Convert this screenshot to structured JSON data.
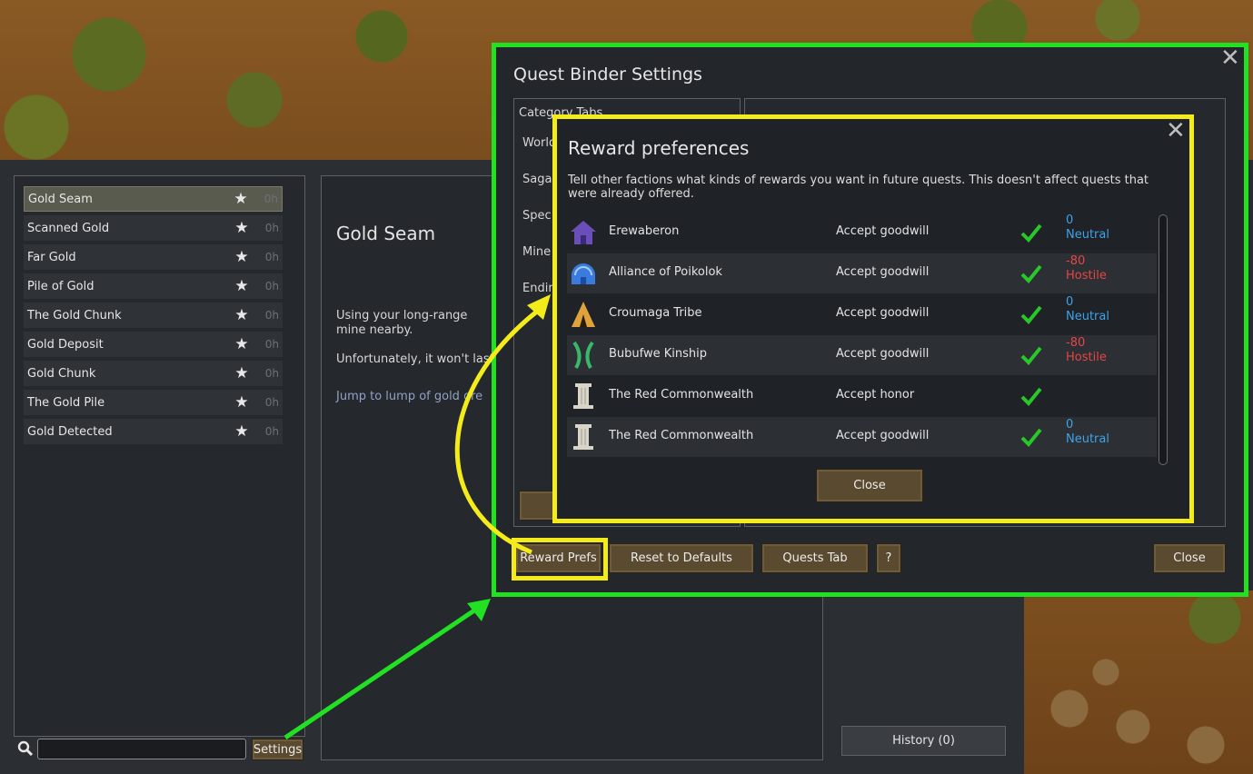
{
  "quest_list": {
    "items": [
      {
        "label": "Gold Seam",
        "time": "0h",
        "selected": true
      },
      {
        "label": "Scanned Gold",
        "time": "0h"
      },
      {
        "label": "Far Gold",
        "time": "0h"
      },
      {
        "label": "Pile of Gold",
        "time": "0h"
      },
      {
        "label": "The Gold Chunk",
        "time": "0h"
      },
      {
        "label": "Gold Deposit",
        "time": "0h"
      },
      {
        "label": "Gold Chunk",
        "time": "0h"
      },
      {
        "label": "The Gold Pile",
        "time": "0h"
      },
      {
        "label": "Gold Detected",
        "time": "0h"
      }
    ],
    "search_value": "",
    "settings_label": "Settings"
  },
  "detail": {
    "title": "Gold Seam",
    "text1": "Using your long-range mine nearby.",
    "text2": "Unfortunately, it won't last -",
    "link": "Jump to lump of gold ore",
    "history_label": "History (0)"
  },
  "settings": {
    "title": "Quest Binder Settings",
    "category_header": "Category Tabs",
    "categories": [
      "World",
      "Saga",
      "Spec",
      "Mine",
      "Endin"
    ],
    "buttons": {
      "reward_prefs": "Reward Prefs",
      "reset": "Reset to Defaults",
      "quests_tab": "Quests Tab",
      "help": "?",
      "close": "Close"
    }
  },
  "reward_prefs": {
    "title": "Reward preferences",
    "description": "Tell other factions what kinds of rewards you want in future quests. This doesn't affect quests that were already offered.",
    "close_label": "Close",
    "factions": [
      {
        "name": "Erewaberon",
        "pref": "Accept goodwill",
        "goodwill": "0",
        "relation": "Neutral",
        "icon": "house-icon",
        "color": "#6a4fb8"
      },
      {
        "name": "Alliance of Poikolok",
        "pref": "Accept goodwill",
        "goodwill": "-80",
        "relation": "Hostile",
        "icon": "dome-icon",
        "color": "#3a7be0"
      },
      {
        "name": "Croumaga Tribe",
        "pref": "Accept goodwill",
        "goodwill": "0",
        "relation": "Neutral",
        "icon": "tent-icon",
        "color": "#e0a23a"
      },
      {
        "name": "Bubufwe Kinship",
        "pref": "Accept goodwill",
        "goodwill": "-80",
        "relation": "Hostile",
        "icon": "crossed-sticks-icon",
        "color": "#39b86a"
      },
      {
        "name": "The Red Commonwealth",
        "pref": "Accept honor",
        "goodwill": "",
        "relation": "",
        "icon": "pillar-icon",
        "color": "#d8d4c8"
      },
      {
        "name": "The Red Commonwealth",
        "pref": "Accept goodwill",
        "goodwill": "0",
        "relation": "Neutral",
        "icon": "pillar-icon",
        "color": "#d8d4c8"
      }
    ]
  },
  "colors": {
    "neutral": "#3fa3e6",
    "hostile": "#e64545",
    "highlight_green": "#22e022",
    "highlight_yellow": "#f4ec1a"
  }
}
